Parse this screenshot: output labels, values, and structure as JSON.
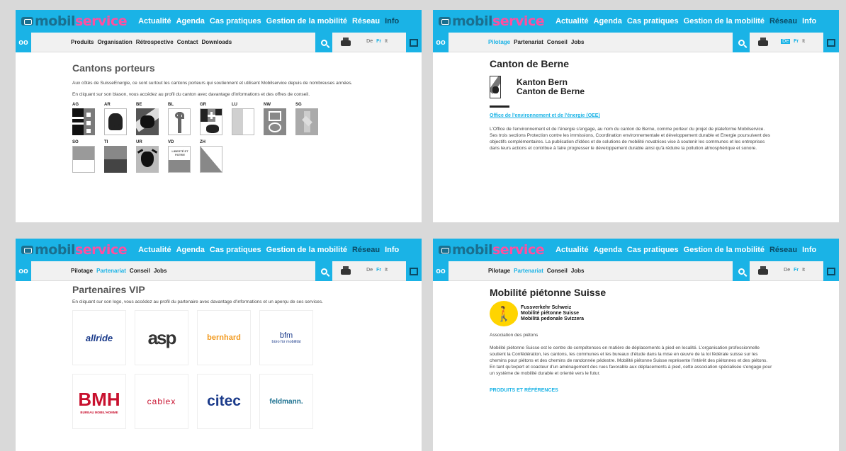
{
  "header": {
    "logo_prefix": "mobil",
    "logo_suffix": "service",
    "main_nav": [
      "Actualité",
      "Agenda",
      "Cas pratiques",
      "Gestion de la mobilité",
      "Réseau",
      "Info"
    ],
    "langs": [
      "De",
      "Fr",
      "It"
    ]
  },
  "panel1": {
    "sub_nav": [
      "Produits",
      "Organisation",
      "Rétrospective",
      "Contact",
      "Downloads"
    ],
    "title": "Cantons porteurs",
    "text1": "Aux côtés de SuisseEnergie, ce sont surtout les cantons porteurs qui soutiennent et utilisent Mobilservice depuis de nombreuses années.",
    "text2": "En cliquant sur son blason, vous accédez au profil du canton avec davantage d'informations et des offres de conseil.",
    "cantons": [
      "AG",
      "AR",
      "BE",
      "BL",
      "GR",
      "LU",
      "NW",
      "SG",
      "SO",
      "TI",
      "UR",
      "VD",
      "ZH"
    ],
    "vd_motto": "LIBERTÉ ET PATRIE"
  },
  "panel2": {
    "sub_nav": [
      "Pilotage",
      "Partenariat",
      "Conseil",
      "Jobs"
    ],
    "title": "Canton de Berne",
    "name_line1": "Kanton Bern",
    "name_line2": "Canton de Berne",
    "link": "Office de l'environnement et de l'énergie (OEE)",
    "text": "L'Office de l'environnement et de l'énergie s'engage, au nom du canton de Berne, comme porteur du projet de plateforme Mobilservice. Ses trois sections Protection contre les immissions, Coordination environnementale et développement durable et Energie poursuivent des objectifs complémentaires. La publication d'idées et de solutions de mobilité novatrices vise à soutenir les communes et les entreprises dans leurs actions et contribue à faire progresser le développement durable ainsi qu'à réduire la pollution atmosphérique et sonore."
  },
  "panel3": {
    "sub_nav": [
      "Pilotage",
      "Partenariat",
      "Conseil",
      "Jobs"
    ],
    "title": "Partenaires VIP",
    "text": "En cliquant sur son logo, vous accédez au profil du partenaire avec davantage d'informations et un aperçu de ses services.",
    "partners": [
      {
        "name": "allride",
        "color": "#1a3a8a"
      },
      {
        "name": "asp",
        "color": "#333333"
      },
      {
        "name": "bernhard",
        "color": "#f29a1f"
      },
      {
        "name": "bfm",
        "color": "#1a3a8a"
      },
      {
        "name": "BMH",
        "color": "#c8102e"
      },
      {
        "name": "cablex",
        "color": "#c8102e"
      },
      {
        "name": "citec",
        "color": "#1a3a8a"
      },
      {
        "name": "feldmann.",
        "color": "#1a6f8f"
      }
    ],
    "bfm_sub": "büro für mobilität",
    "bmh_sub": "BUREAU MOBIL'HOMME"
  },
  "panel4": {
    "sub_nav": [
      "Pilotage",
      "Partenariat",
      "Conseil",
      "Jobs"
    ],
    "title": "Mobilité piétonne Suisse",
    "logo_lines": [
      "Fussverkehr Schweiz",
      "Mobilité piétonne Suisse",
      "Mobilità pedonale Svizzera"
    ],
    "subtitle": "Association des piétons",
    "text": "Mobilité piétonne Suisse est le centre de compétences en matière de déplacements à pied en localité. L'organisation professionnelle soutient la Confédération, les cantons, les communes et les bureaux d'étude dans la mise en œuvre de la loi fédérale suisse sur les chemins pour piétons et des chemins de randonnée pédestre. Mobilité piétonne Suisse représente l'intérêt des piétonnes et des piétons. En tant qu'expert et coacteur d'un aménagement des rues favorable aux déplacements à pied, cette association spécialisée s'engage pour un système de mobilité durable et orienté vers le futur.",
    "section_link": "PRODUITS ET RÉFÉRENCES"
  },
  "colors": {
    "accent": "#1ab3e6",
    "logo_dark": "#1a6f8f",
    "logo_pink": "#ff4fa0"
  }
}
